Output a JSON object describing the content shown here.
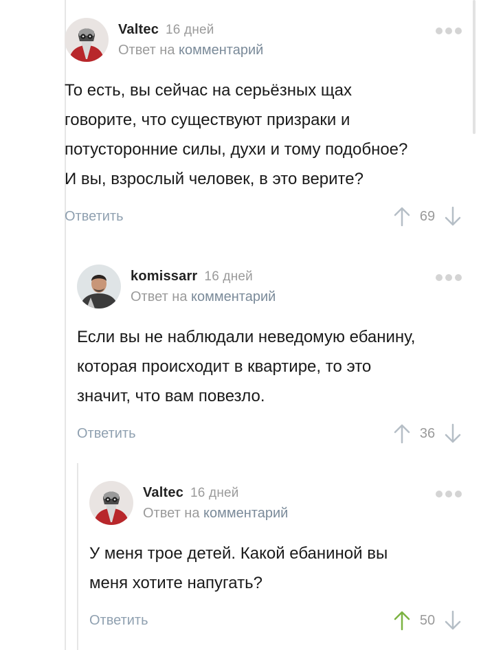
{
  "comments": [
    {
      "author": "Valtec",
      "age": "16 дней",
      "reply_prefix": "Ответ на",
      "reply_link": "комментарий",
      "body": [
        "То есть, вы сейчас на серьёзных щах",
        "говорите, что существуют призраки и",
        "потусторонние силы, духи и тому подобное?",
        "И вы, взрослый человек, в это верите?"
      ],
      "reply_label": "Ответить",
      "rating": "69",
      "upvoted": false
    },
    {
      "author": "komissarr",
      "age": "16 дней",
      "reply_prefix": "Ответ на",
      "reply_link": "комментарий",
      "body": [
        "Если вы не наблюдали неведомую ебанину,",
        "которая происходит в квартире, то это",
        "значит, что вам повезло."
      ],
      "reply_label": "Ответить",
      "rating": "36",
      "upvoted": false
    },
    {
      "author": "Valtec",
      "age": "16 дней",
      "reply_prefix": "Ответ на",
      "reply_link": "комментарий",
      "body": [
        "У меня трое детей. Какой ебаниной вы",
        "меня хотите напугать?"
      ],
      "reply_label": "Ответить",
      "rating": "50",
      "upvoted": true
    }
  ],
  "colors": {
    "upvote_active": "#7cb342",
    "arrow_default": "#b5bec6",
    "link": "#7a8a99",
    "muted": "#9a9a9a"
  }
}
